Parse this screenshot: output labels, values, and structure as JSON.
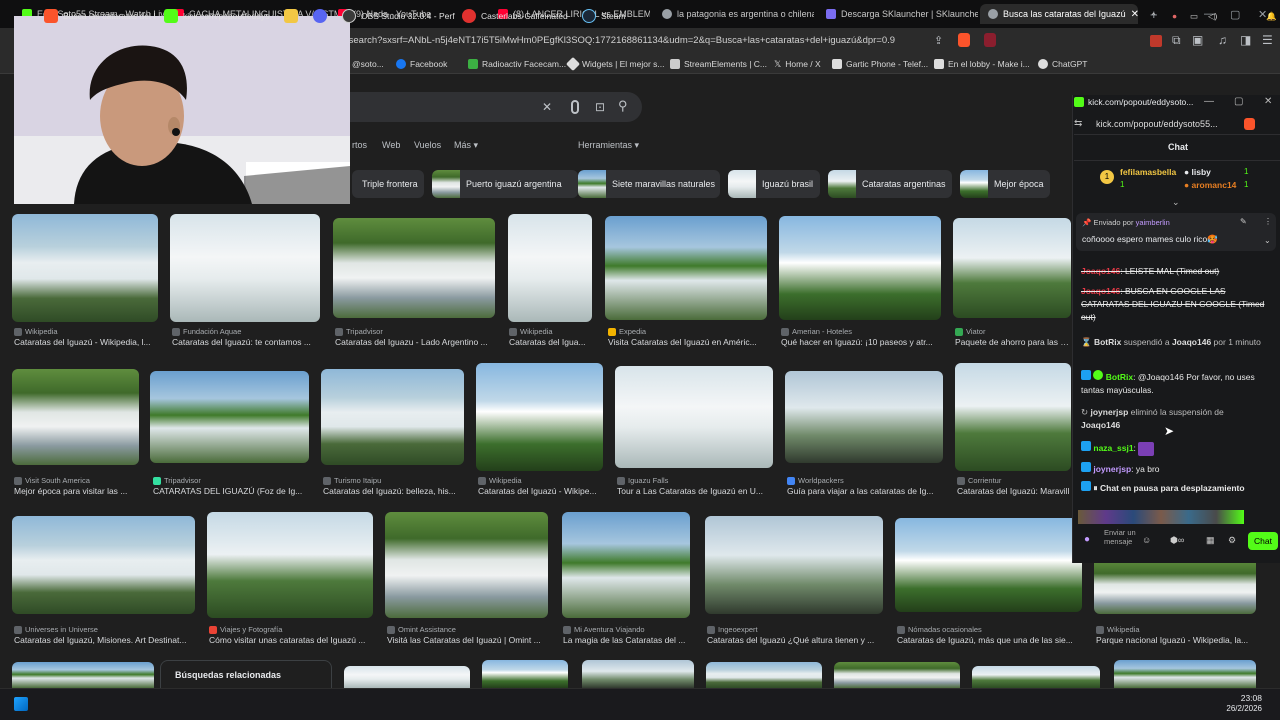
{
  "tabs": [
    {
      "label": "EddySoto55 Stream - Watch Live on",
      "color": "#53fc18"
    },
    {
      "label": "CACHA METALINGUISTICA V/S STM",
      "color": "#ff0033"
    },
    {
      "label": "(9) Nada - YouTube",
      "color": "#ff0033"
    },
    {
      "label": "(8) LANCER LIRICAL vs EMBLEMA - C",
      "color": "#ff0033"
    },
    {
      "label": "la patagonia es argentina o chilena",
      "color": "#9aa0a6"
    },
    {
      "label": "Descarga SKlauncher | SKlauncher",
      "color": "#7a6cf0"
    },
    {
      "label": "Busca las cataratas del Iguazú",
      "color": "#9aa0a6"
    }
  ],
  "url": "/search?sxsrf=ANbL-n5j4eNT17i5T5iMwHm0PEgfKl3SOQ:1772168861134&udm=2&q=Busca+las+cataratas+del+iguazú&dpr=0.9",
  "bookmarks": [
    "@soto...",
    "Facebook",
    "Radioactiv Facecam...",
    "Widgets | El mejor s...",
    "StreamElements | C...",
    "Home / X",
    "Gartic Phone - Telef...",
    "En el lobby - Make i...",
    "ChatGPT"
  ],
  "gtabs": [
    "rtos",
    "Web",
    "Vuelos",
    "Más",
    "Herramientas"
  ],
  "chips": [
    "Triple frontera",
    "Puerto iguazú argentina",
    "Siete maravillas naturales",
    "Iguazú brasil",
    "Cataratas argentinas",
    "Mejor época"
  ],
  "row1": [
    {
      "src": "Wikipedia",
      "title": "Cataratas del Iguazú - Wikipedia, l..."
    },
    {
      "src": "Fundación Aquae",
      "title": "Cataratas del Iguazú: te contamos ..."
    },
    {
      "src": "Tripadvisor",
      "title": "Cataratas del Iguazu - Lado Argentino ..."
    },
    {
      "src": "Wikipedia",
      "title": "Cataratas del Igua..."
    },
    {
      "src": "Expedia",
      "title": "Visita Cataratas del Iguazú en Améric..."
    },
    {
      "src": "Amerian - Hoteles",
      "title": "Qué hacer en Iguazú: ¡10 paseos y atr..."
    },
    {
      "src": "Viator",
      "title": "Paquete de ahorro para las Ca"
    }
  ],
  "row2": [
    {
      "src": "Visit South America",
      "title": "Mejor época para visitar las ..."
    },
    {
      "src": "Tripadvisor",
      "title": "CATARATAS DEL IGUAZÚ (Foz de Ig..."
    },
    {
      "src": "Turismo Itaipu",
      "title": "Cataratas del Iguazú: belleza, his..."
    },
    {
      "src": "Wikipedia",
      "title": "Cataratas del Iguazú - Wikipe..."
    },
    {
      "src": "Iguazu Falls",
      "title": "Tour a Las Cataratas de Iguazú en U..."
    },
    {
      "src": "Worldpackers",
      "title": "Guía para viajar a las cataratas de Ig..."
    },
    {
      "src": "Corrientur",
      "title": "Cataratas del Iguazú: Maravill"
    }
  ],
  "row3": [
    {
      "src": "Universes in Universe",
      "title": "Cataratas del Iguazú, Misiones. Art Destinat..."
    },
    {
      "src": "Viajes y Fotografía",
      "title": "Cómo visitar unas cataratas del Iguazú ..."
    },
    {
      "src": "Omint Assistance",
      "title": "Visitá las Cataratas del Iguazú | Omint ..."
    },
    {
      "src": "Mi Aventura Viajando",
      "title": "La magia de las Cataratas del ..."
    },
    {
      "src": "Ingeoexpert",
      "title": "Cataratas del Iguazú ¿Qué altura tienen y ..."
    },
    {
      "src": "Nómadas ocasionales",
      "title": "Cataratas de Iguazú, más que una de las sie..."
    },
    {
      "src": "Wikipedia",
      "title": "Parque nacional Iguazú - Wikipedia, la..."
    }
  ],
  "related": "Búsquedas relacionadas",
  "kick": {
    "window_title": "kick.com/popout/eddysoto...",
    "addr": "kick.com/popout/eddysoto55...",
    "chat_header": "Chat",
    "lb1_name": "fefilamasbella",
    "lb1_n": "1",
    "lb2_name": "lisby",
    "lb2_n": "1",
    "lb3_name": "aromanc14",
    "lb3_n": "1",
    "pinned_by": "Enviado por",
    "pinned_user": "yaimberlin",
    "pinned_msg": "coñoooo espero mames culo rico🥵",
    "m1_user": "Joaqo146",
    "m1_text": "LEISTE MAL (Timed out)",
    "m2_user": "Joaqo146",
    "m2_text": "BUSCA EN GOOGLE LAS CATARATAS DEL IGUAZU EN GOOGLE (Timed out)",
    "m3_user": "BotRix",
    "m3_text": "suspendió a",
    "m3_target": "Joaqo146",
    "m3_tail": "por 1 minuto",
    "m4_user": "BotRix",
    "m4_text": "@Joaqo146 Por favor, no uses tantas mayúsculas.",
    "m5_user": "joynerjsp",
    "m5_text": "eliminó la suspensión de",
    "m5_target": "Joaqo146",
    "m6_user": "naza_ssj1",
    "m7_user": "joynerjsp",
    "m7_text": "ya bro",
    "paused": "Chat en pausa para desplazamiento",
    "send_placeholder": "Enviar un mensaje",
    "chat_button": "Chat"
  },
  "taskbar": [
    {
      "label": "Busca las cataratas del I",
      "color": "#fb542b"
    },
    {
      "label": "kick.com/popout/eddys",
      "color": "#53fc18"
    },
    {
      "label": "",
      "color": "#f2c744"
    },
    {
      "label": "",
      "color": "#5865f2"
    },
    {
      "label": "OBS Studio 32.0.4 - Perf",
      "color": "#3a3a3a"
    },
    {
      "label": "Casterlabs-Caffeinated",
      "color": "#e0312f"
    },
    {
      "label": "Steam",
      "color": "#1b2838"
    }
  ],
  "clock_time": "23:08",
  "clock_date": "26/2/2026"
}
